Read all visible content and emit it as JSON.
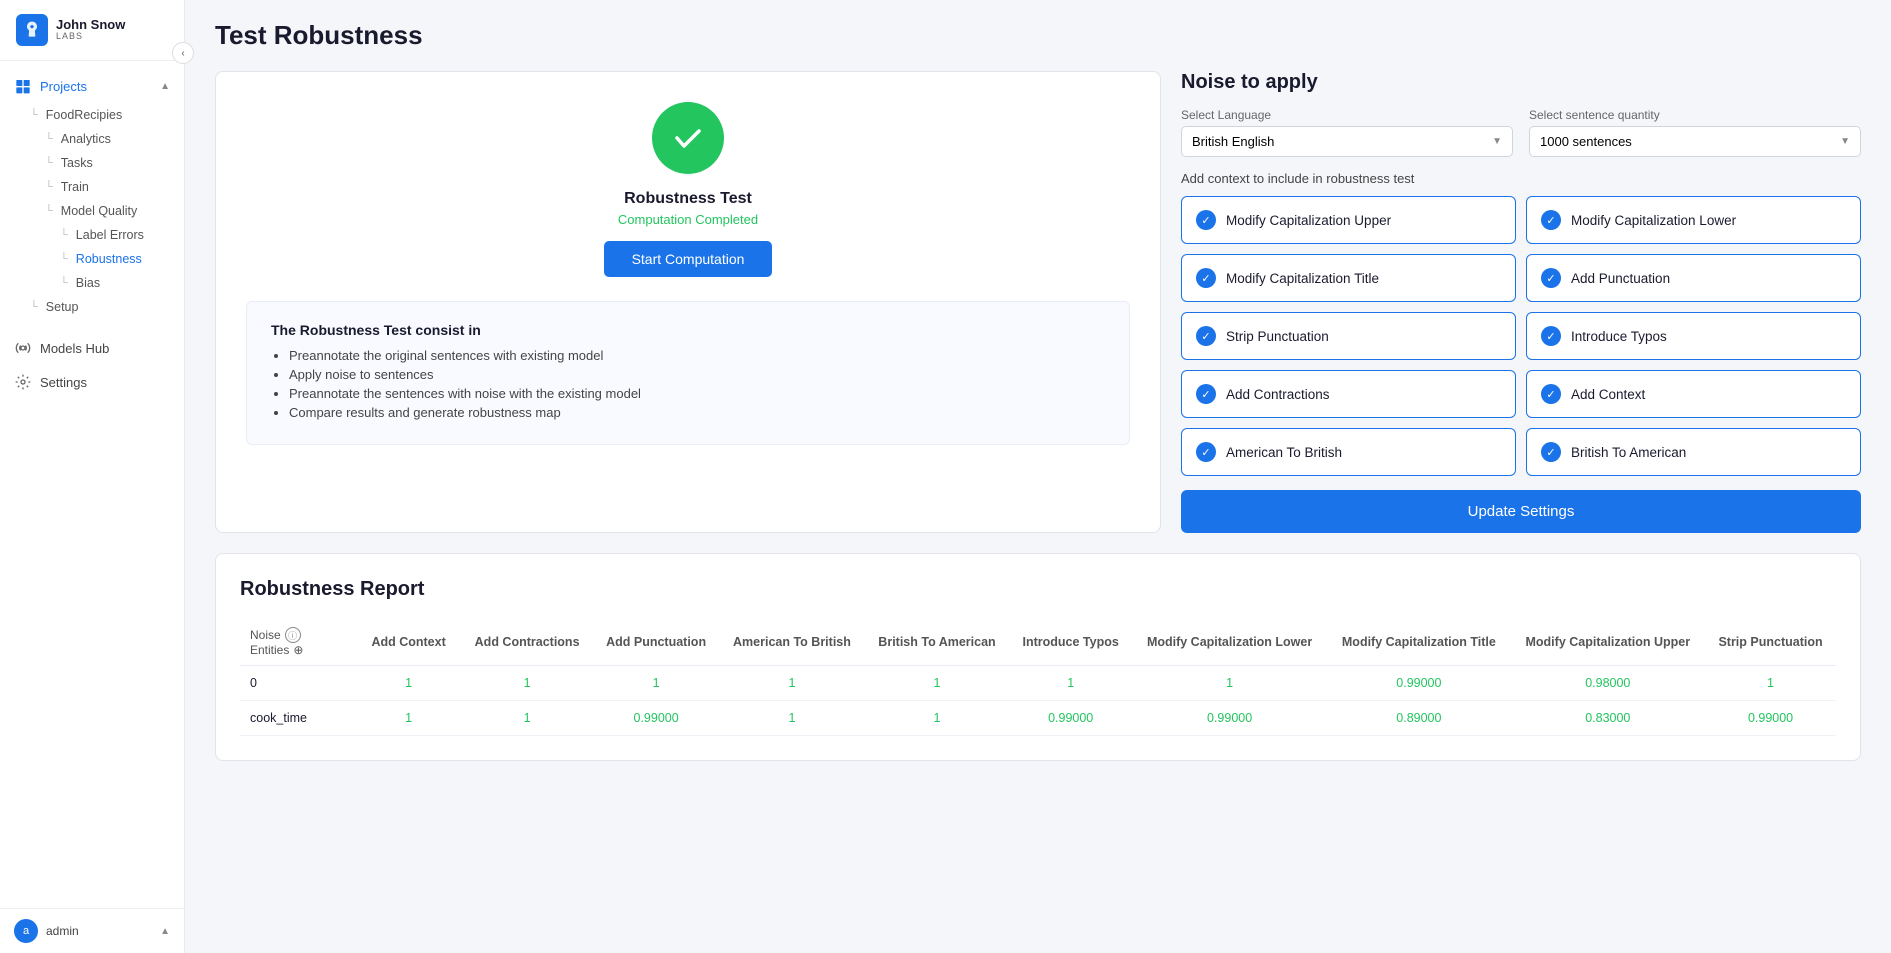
{
  "app": {
    "logo_name": "John Snow",
    "logo_sub": "LABS"
  },
  "sidebar": {
    "projects_label": "Projects",
    "food_recipes": "FoodRecipies",
    "analytics": "Analytics",
    "tasks": "Tasks",
    "train": "Train",
    "model_quality": "Model Quality",
    "label_errors": "Label Errors",
    "robustness": "Robustness",
    "bias": "Bias",
    "setup": "Setup",
    "models_hub": "Models Hub",
    "settings": "Settings",
    "admin_label": "admin",
    "avatar_letter": "a",
    "collapse_icon": "‹"
  },
  "page": {
    "title": "Test Robustness"
  },
  "robustness_card": {
    "title": "Robustness Test",
    "status": "Computation Completed",
    "start_button": "Start Computation",
    "desc_title": "The Robustness Test consist in",
    "desc_items": [
      "Preannotate the original sentences with existing model",
      "Apply noise to sentences",
      "Preannotate the sentences with noise with the existing model",
      "Compare results and generate robustness map"
    ]
  },
  "noise_panel": {
    "title": "Noise to apply",
    "select_language_label": "Select Language",
    "selected_language": "British English",
    "select_quantity_label": "Select sentence quantity",
    "selected_quantity": "1000 sentences",
    "context_label": "Add context to include in robustness test",
    "update_button": "Update Settings",
    "options": [
      {
        "label": "Modify Capitalization Upper",
        "checked": true
      },
      {
        "label": "Modify Capitalization Lower",
        "checked": true
      },
      {
        "label": "Modify Capitalization Title",
        "checked": true
      },
      {
        "label": "Add Punctuation",
        "checked": true
      },
      {
        "label": "Strip Punctuation",
        "checked": true
      },
      {
        "label": "Introduce Typos",
        "checked": true
      },
      {
        "label": "Add Contractions",
        "checked": true
      },
      {
        "label": "Add Context",
        "checked": true
      },
      {
        "label": "American To British",
        "checked": true
      },
      {
        "label": "British To American",
        "checked": true
      }
    ]
  },
  "report": {
    "title": "Robustness Report",
    "noise_label": "Noise",
    "entities_label": "Entities",
    "columns": [
      "Add Context",
      "Add Contractions",
      "Add Punctuation",
      "American To British",
      "British To American",
      "Introduce Typos",
      "Modify Capitalization Lower",
      "Modify Capitalization Title",
      "Modify Capitalization Upper",
      "Strip Punctuation"
    ],
    "rows": [
      {
        "entity": "0",
        "values": [
          "1",
          "1",
          "1",
          "1",
          "1",
          "1",
          "1",
          "0.99000",
          "0.98000",
          "1"
        ]
      },
      {
        "entity": "cook_time",
        "values": [
          "1",
          "1",
          "0.99000",
          "1",
          "1",
          "0.99000",
          "0.99000",
          "0.89000",
          "0.83000",
          "0.99000"
        ]
      }
    ]
  }
}
